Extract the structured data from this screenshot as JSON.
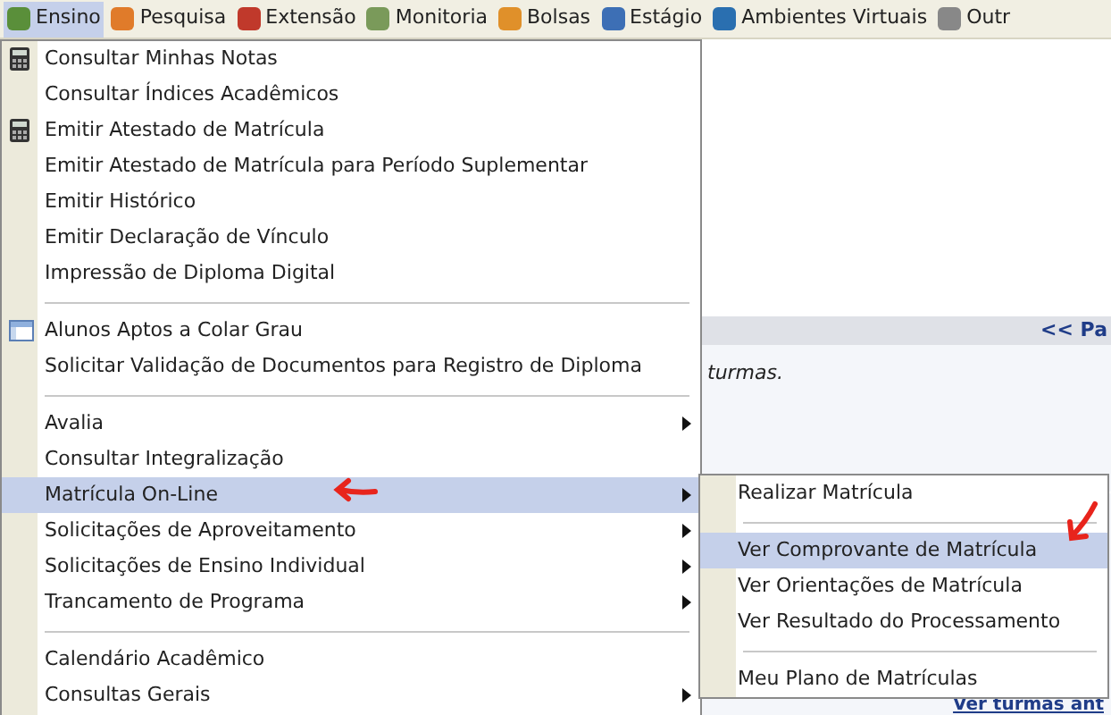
{
  "menubar": [
    {
      "label": "Ensino",
      "selected": true
    },
    {
      "label": "Pesquisa",
      "selected": false
    },
    {
      "label": "Extensão",
      "selected": false
    },
    {
      "label": "Monitoria",
      "selected": false
    },
    {
      "label": "Bolsas",
      "selected": false
    },
    {
      "label": "Estágio",
      "selected": false
    },
    {
      "label": "Ambientes Virtuais",
      "selected": false
    },
    {
      "label": "Outr",
      "selected": false
    }
  ],
  "page": {
    "header_link": "<< Pa",
    "note": "turmas.",
    "footer_link": "Ver turmas ant"
  },
  "menu": {
    "items": [
      {
        "kind": "calculator",
        "label": "Consultar Minhas Notas",
        "submenu": false,
        "selected": false
      },
      {
        "kind": "plain",
        "label": "Consultar Índices Acadêmicos",
        "submenu": false,
        "selected": false
      },
      {
        "kind": "calculator",
        "label": "Emitir Atestado de Matrícula",
        "submenu": false,
        "selected": false
      },
      {
        "kind": "plain",
        "label": "Emitir Atestado de Matrícula para Período Suplementar",
        "submenu": false,
        "selected": false
      },
      {
        "kind": "plain",
        "label": "Emitir Histórico",
        "submenu": false,
        "selected": false
      },
      {
        "kind": "plain",
        "label": "Emitir Declaração de Vínculo",
        "submenu": false,
        "selected": false
      },
      {
        "kind": "plain",
        "label": "Impressão de Diploma Digital",
        "submenu": false,
        "selected": false
      },
      {
        "kind": "separator"
      },
      {
        "kind": "table",
        "label": "Alunos Aptos a Colar Grau",
        "submenu": false,
        "selected": false
      },
      {
        "kind": "plain",
        "label": "Solicitar Validação de Documentos para Registro de Diploma",
        "submenu": false,
        "selected": false
      },
      {
        "kind": "separator"
      },
      {
        "kind": "plain",
        "label": "Avalia",
        "submenu": true,
        "selected": false
      },
      {
        "kind": "plain",
        "label": "Consultar Integralização",
        "submenu": false,
        "selected": false
      },
      {
        "kind": "plain",
        "label": "Matrícula On-Line",
        "submenu": true,
        "selected": true
      },
      {
        "kind": "plain",
        "label": "Solicitações de Aproveitamento",
        "submenu": true,
        "selected": false
      },
      {
        "kind": "plain",
        "label": "Solicitações de Ensino Individual",
        "submenu": true,
        "selected": false
      },
      {
        "kind": "plain",
        "label": "Trancamento de Programa",
        "submenu": true,
        "selected": false
      },
      {
        "kind": "separator"
      },
      {
        "kind": "plain",
        "label": "Calendário Acadêmico",
        "submenu": false,
        "selected": false
      },
      {
        "kind": "plain",
        "label": "Consultas Gerais",
        "submenu": true,
        "selected": false
      }
    ]
  },
  "submenu": {
    "items": [
      {
        "kind": "plain",
        "label": "Realizar Matrícula",
        "selected": false
      },
      {
        "kind": "separator"
      },
      {
        "kind": "plain",
        "label": "Ver Comprovante de Matrícula",
        "selected": true
      },
      {
        "kind": "plain",
        "label": "Ver Orientações de Matrícula",
        "selected": false
      },
      {
        "kind": "plain",
        "label": "Ver Resultado do Processamento",
        "selected": false
      },
      {
        "kind": "separator"
      },
      {
        "kind": "plain",
        "label": "Meu Plano de Matrículas",
        "selected": false
      }
    ]
  }
}
